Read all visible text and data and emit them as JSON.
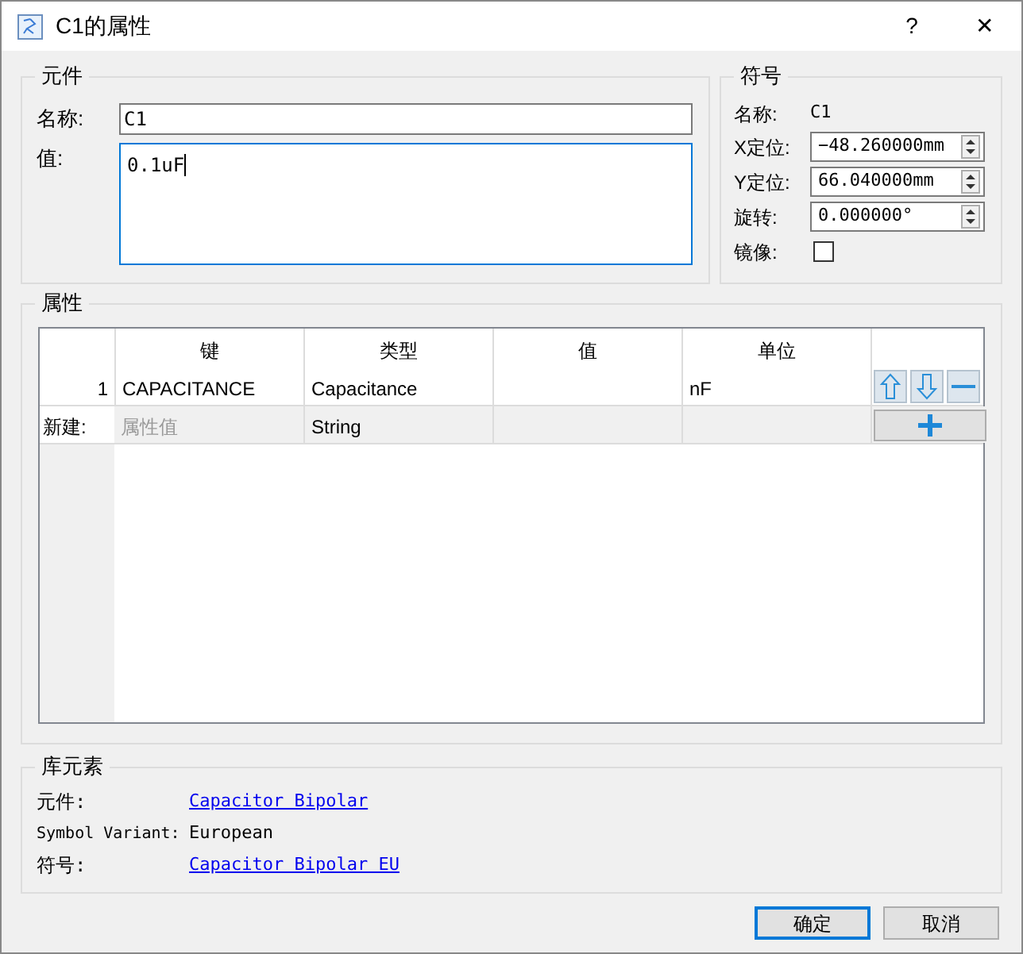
{
  "window": {
    "title": "C1的属性",
    "help": "?",
    "close": "✕"
  },
  "component": {
    "title": "元件",
    "name_label": "名称:",
    "name_value": "C1",
    "value_label": "值:",
    "value_value": "0.1uF"
  },
  "symbol": {
    "title": "符号",
    "name_label": "名称:",
    "name_value": "C1",
    "fields": [
      {
        "label": "X定位:",
        "value": "−48.260000mm"
      },
      {
        "label": "Y定位:",
        "value": "66.040000mm"
      },
      {
        "label": "旋转:",
        "value": "0.000000°"
      }
    ],
    "mirror_label": "镜像:",
    "mirror_checked": false
  },
  "properties": {
    "title": "属性",
    "columns": [
      "键",
      "类型",
      "值",
      "单位"
    ],
    "rows": [
      {
        "index": "1",
        "cells": [
          "CAPACITANCE",
          "Capacitance",
          "",
          "nF"
        ]
      }
    ],
    "new_row": {
      "label": "新建:",
      "key_placeholder": "属性值",
      "type": "String"
    }
  },
  "library": {
    "title": "库元素",
    "rows": [
      {
        "label": "元件:",
        "value": "Capacitor Bipolar",
        "kind": "link"
      },
      {
        "label": "Symbol Variant:",
        "value": "European",
        "kind": "text"
      },
      {
        "label": "符号:",
        "value": "Capacitor Bipolar EU",
        "kind": "link"
      }
    ]
  },
  "buttons": [
    {
      "label": "确定",
      "default": true
    },
    {
      "label": "取消",
      "default": false
    }
  ]
}
